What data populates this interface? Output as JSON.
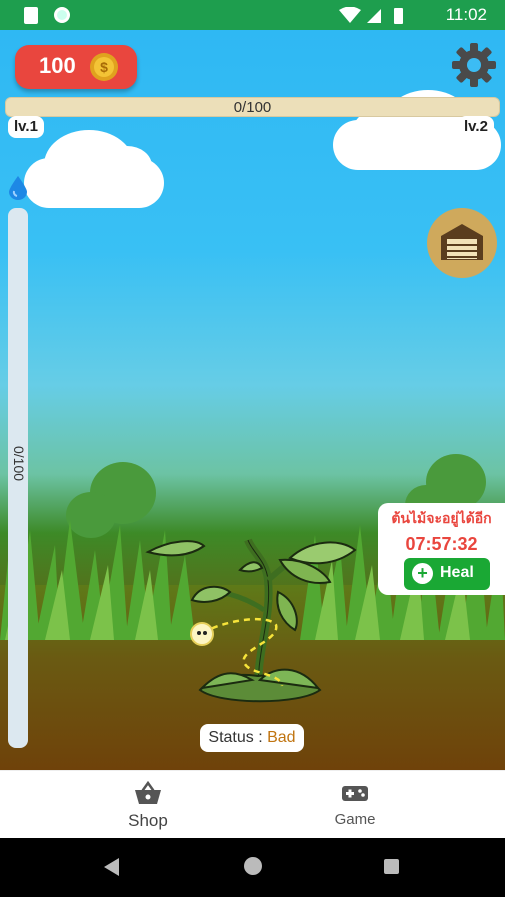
{
  "status_bar": {
    "time": "11:02",
    "icons": [
      "sd-card-icon",
      "app-notification-icon",
      "wifi-icon",
      "cell-signal-icon",
      "battery-icon"
    ]
  },
  "hud": {
    "coins": "100",
    "xp_text": "0/100",
    "level_current": "lv.1",
    "level_next": "lv.2",
    "water_text": "0/100"
  },
  "notice": {
    "message": "ต้นไม้จะอยู่ได้อีก",
    "timer": "07:57:32",
    "heal_label": "Heal"
  },
  "status": {
    "label": "Status : ",
    "value": "Bad"
  },
  "bottom_nav": {
    "shop_label": "Shop",
    "game_label": "Game"
  },
  "colors": {
    "coin_badge": "#e9463e",
    "heal_button": "#1aa834",
    "status_bad": "#c07410",
    "status_bar": "#1e9e4e"
  }
}
